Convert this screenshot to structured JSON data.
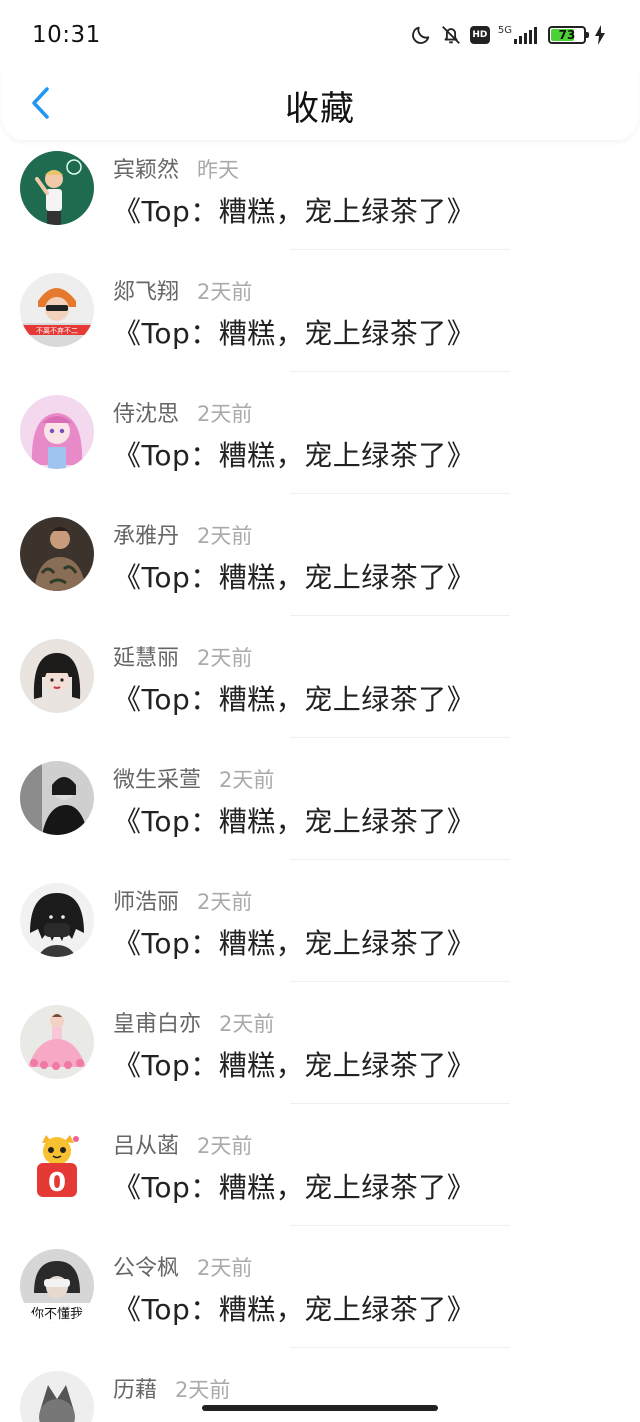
{
  "status_bar": {
    "time": "10:31",
    "icons": [
      "moon-icon",
      "bell-off-icon",
      "hd-icon",
      "signal-icon",
      "battery-icon",
      "charging-icon"
    ],
    "hd_label": "HD",
    "network": "5G",
    "battery": "73",
    "battery_level": 0.73,
    "battery_color": "#4cd137"
  },
  "header": {
    "title": "收藏",
    "back_icon": "chevron-left-icon",
    "accent_color": "#2196f3"
  },
  "items": [
    {
      "name": "宾颖然",
      "time": "昨天",
      "title": "《Top：糟糕，宠上绿茶了》",
      "avatar": "avatar-boy-chalkboard"
    },
    {
      "name": "郯飞翔",
      "time": "2天前",
      "title": "《Top：糟糕，宠上绿茶了》",
      "avatar": "avatar-orange-hair"
    },
    {
      "name": "侍沈思",
      "time": "2天前",
      "title": "《Top：糟糕，宠上绿茶了》",
      "avatar": "avatar-anime-girl"
    },
    {
      "name": "承雅丹",
      "time": "2天前",
      "title": "《Top：糟糕，宠上绿茶了》",
      "avatar": "avatar-tattoo-man"
    },
    {
      "name": "延慧丽",
      "time": "2天前",
      "title": "《Top：糟糕，宠上绿茶了》",
      "avatar": "avatar-dark-hair-girl"
    },
    {
      "name": "微生采萱",
      "time": "2天前",
      "title": "《Top：糟糕，宠上绿茶了》",
      "avatar": "avatar-bw-girl"
    },
    {
      "name": "师浩丽",
      "time": "2天前",
      "title": "《Top：糟糕，宠上绿茶了》",
      "avatar": "avatar-anime-mask"
    },
    {
      "name": "皇甫白亦",
      "time": "2天前",
      "title": "《Top：糟糕，宠上绿茶了》",
      "avatar": "avatar-pink-dress"
    },
    {
      "name": "吕从菡",
      "time": "2天前",
      "title": "《Top：糟糕，宠上绿茶了》",
      "avatar": "avatar-cartoon-cat"
    },
    {
      "name": "公令枫",
      "time": "2天前",
      "title": "《Top：糟糕，宠上绿茶了》",
      "avatar": "avatar-covered-face"
    },
    {
      "name": "历藉",
      "time": "2天前",
      "title": "",
      "avatar": "avatar-wolf"
    }
  ]
}
